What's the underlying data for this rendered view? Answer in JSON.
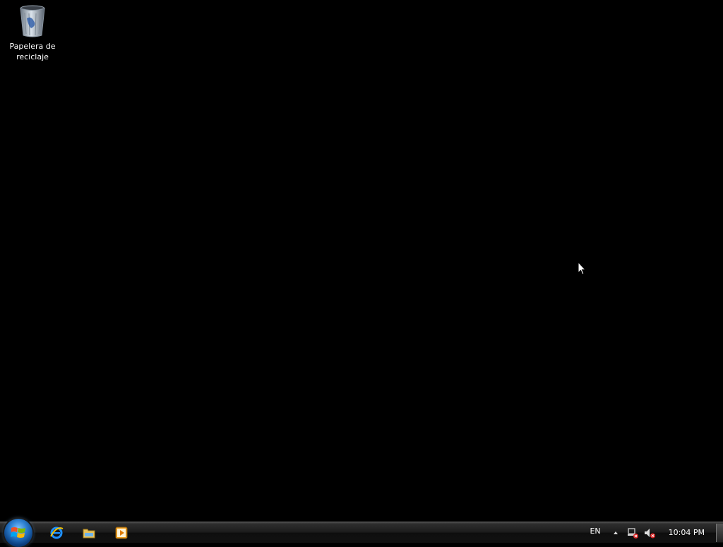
{
  "desktop": {
    "background_color": "#000000",
    "icons": [
      {
        "label": "Papelera de reciclaje",
        "icon": "recycle-bin-icon"
      }
    ]
  },
  "taskbar": {
    "start_button": {
      "icon": "windows-start-orb-icon"
    },
    "quick_launch": [
      {
        "icon": "internet-explorer-icon"
      },
      {
        "icon": "windows-explorer-folder-icon"
      },
      {
        "icon": "media-player-icon"
      }
    ],
    "tray": {
      "language": "EN",
      "show_hidden_icon": "chevron-up-icon",
      "network_icon": "network-disconnected-icon",
      "volume_icon": "volume-muted-icon",
      "clock": "10:04 PM"
    }
  },
  "colors": {
    "taskbar": "#1b1b1b",
    "start_orb": "#2d7fd0",
    "text": "#ffffff"
  }
}
